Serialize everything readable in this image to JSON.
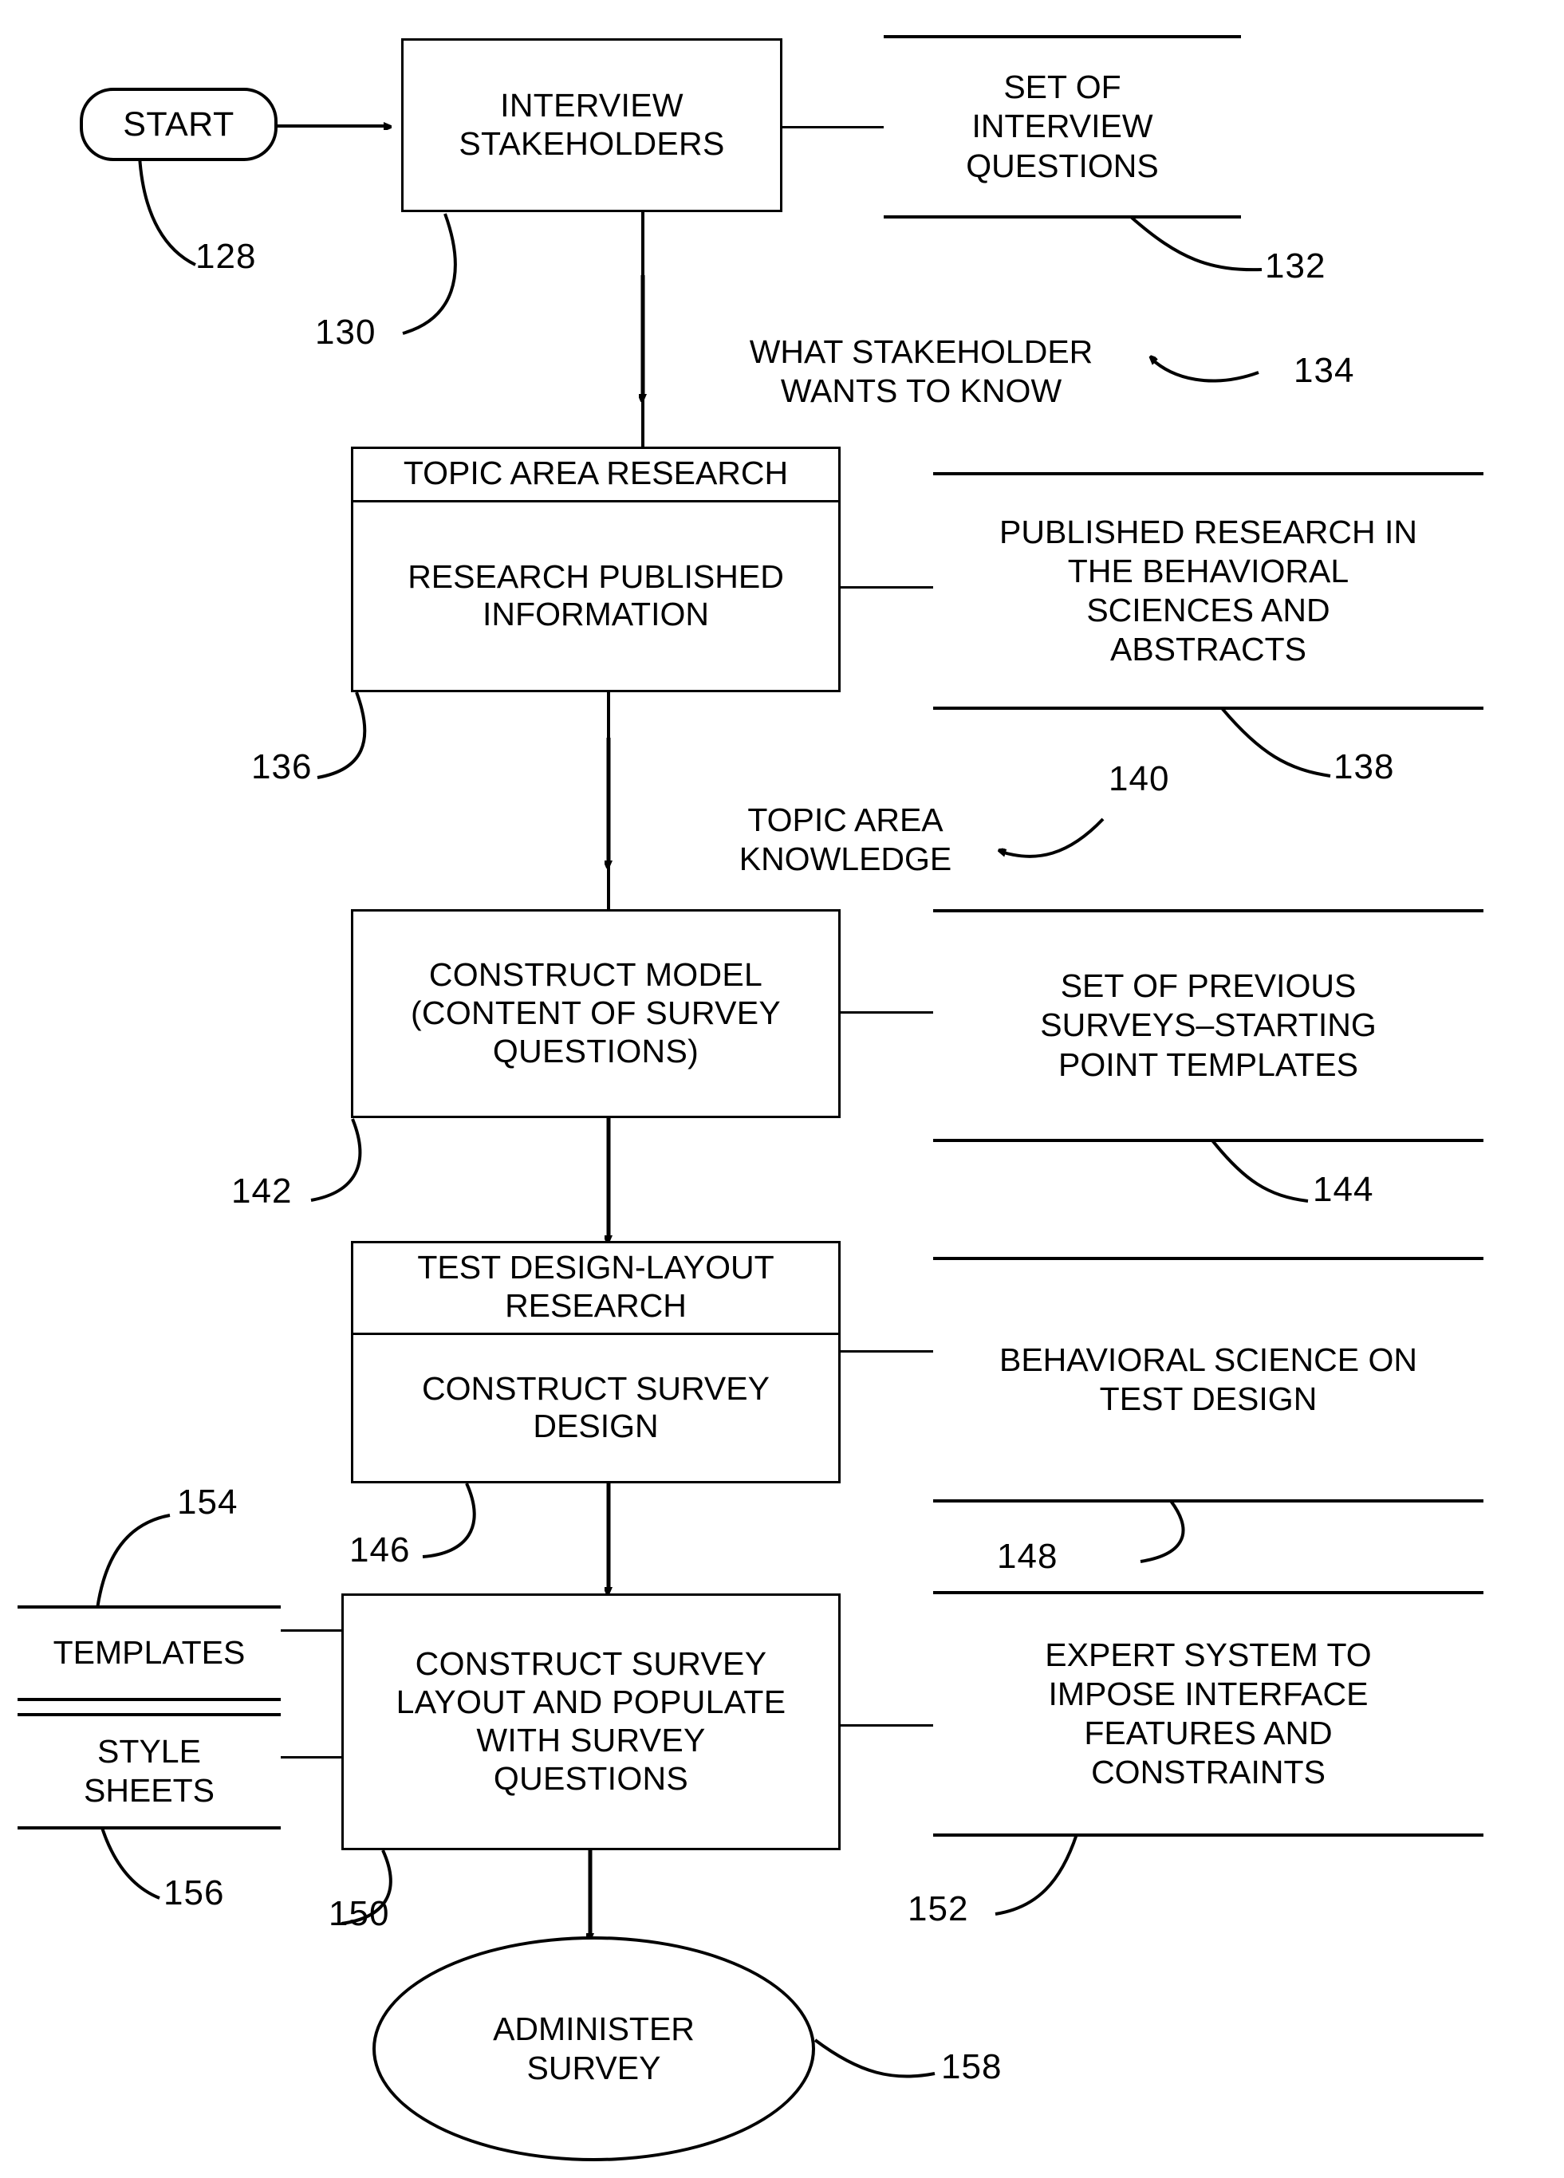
{
  "figure": {
    "title": "Survey construction process flowchart",
    "style": {
      "ink": "#000000",
      "paper": "#ffffff"
    }
  },
  "nodes": {
    "start": {
      "label": "START",
      "ref": "128"
    },
    "interview": {
      "label": "INTERVIEW\nSTAKEHOLDERS",
      "ref": "130"
    },
    "topic_research": {
      "header": "TOPIC AREA RESEARCH",
      "body": "RESEARCH PUBLISHED\nINFORMATION",
      "ref": "136"
    },
    "construct_model": {
      "label": "CONSTRUCT MODEL\n(CONTENT OF SURVEY\nQUESTIONS)",
      "ref": "142"
    },
    "test_design": {
      "header": "TEST DESIGN-LAYOUT\nRESEARCH",
      "body": "CONSTRUCT SURVEY\nDESIGN",
      "ref": "146"
    },
    "construct_layout": {
      "label": "CONSTRUCT SURVEY\nLAYOUT AND POPULATE\nWITH SURVEY\nQUESTIONS",
      "ref": "150"
    },
    "administer": {
      "label": "ADMINISTER\nSURVEY",
      "ref": "158"
    }
  },
  "notes": {
    "interview_questions": {
      "label": "SET OF\nINTERVIEW\nQUESTIONS",
      "ref": "132"
    },
    "published_research": {
      "label": "PUBLISHED RESEARCH IN\nTHE BEHAVIORAL\nSCIENCES AND\nABSTRACTS",
      "ref": "138"
    },
    "previous_surveys": {
      "label": "SET OF PREVIOUS\nSURVEYS–STARTING\nPOINT TEMPLATES",
      "ref": "144"
    },
    "behavioral_science": {
      "label": "BEHAVIORAL SCIENCE ON\nTEST DESIGN",
      "ref": "148"
    },
    "expert_system": {
      "label": "EXPERT SYSTEM TO\nIMPOSE INTERFACE\nFEATURES AND\nCONSTRAINTS",
      "ref": "152"
    },
    "templates": {
      "label": "TEMPLATES",
      "ref": "154"
    },
    "style_sheets": {
      "label": "STYLE\nSHEETS",
      "ref": "156"
    }
  },
  "flow_labels": {
    "stakeholder_wants": {
      "label": "WHAT STAKEHOLDER\nWANTS TO KNOW",
      "ref": "134"
    },
    "topic_knowledge": {
      "label": "TOPIC AREA\nKNOWLEDGE",
      "ref": "140"
    }
  }
}
